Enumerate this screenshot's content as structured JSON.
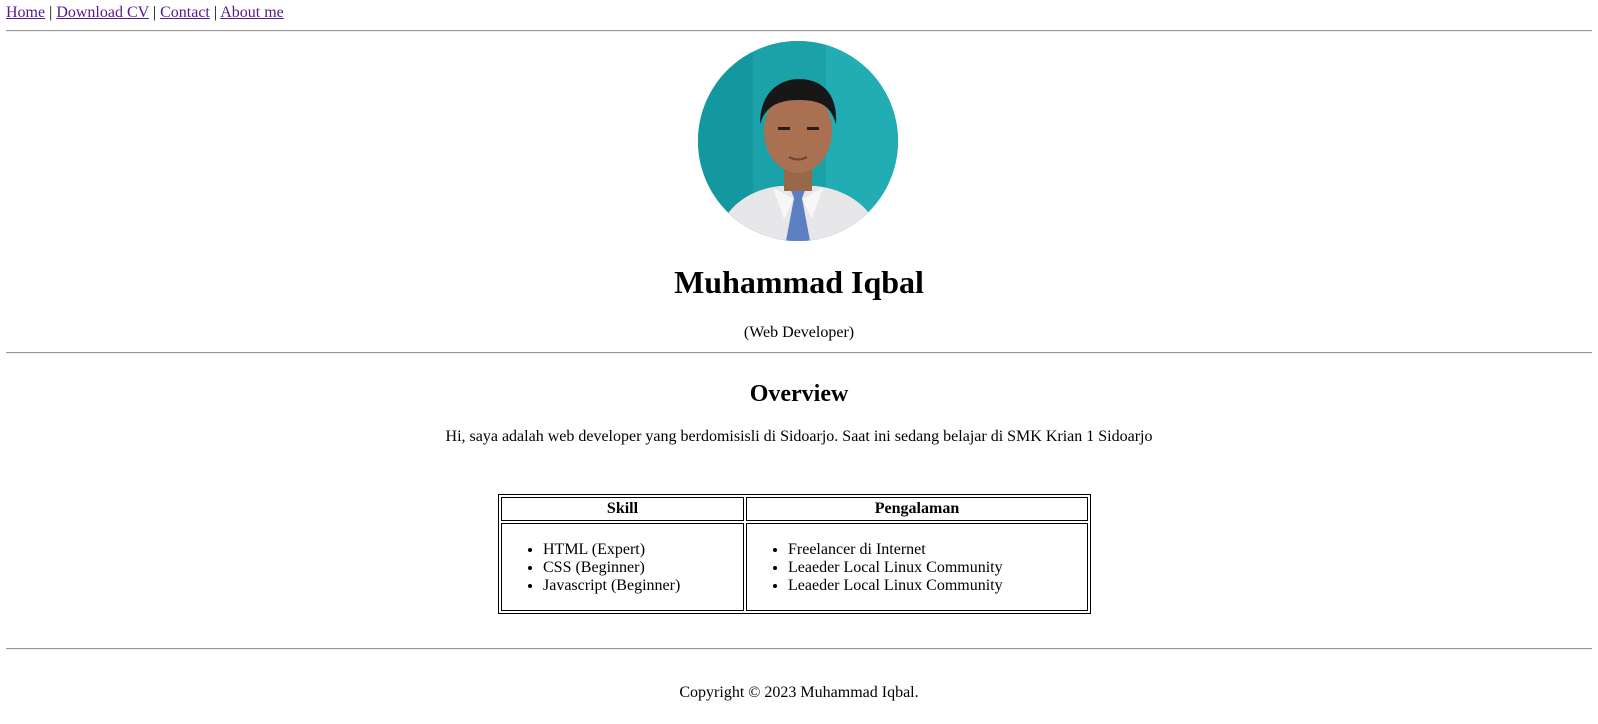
{
  "nav": {
    "home": "Home",
    "download_cv": "Download CV",
    "contact": "Contact",
    "about": "About me",
    "separator": "|"
  },
  "profile": {
    "photo_description": "profile photo",
    "name": "Muhammad Iqbal",
    "role": "(Web Developer)"
  },
  "overview": {
    "heading": "Overview",
    "text": "Hi, saya adalah web developer yang berdomisisli di Sidoarjo. Saat ini sedang belajar di SMK Krian 1 Sidoarjo"
  },
  "table": {
    "headers": [
      "Skill",
      "Pengalaman"
    ],
    "skills": [
      "HTML (Expert)",
      "CSS (Beginner)",
      "Javascript (Beginner)"
    ],
    "experience": [
      "Freelancer di Internet",
      "Leaeder Local Linux Community",
      "Leaeder Local Linux Community"
    ]
  },
  "footer": {
    "copyright": "Copyright © 2023 Muhammad Iqbal."
  },
  "colors": {
    "link_visited": "#551a8b",
    "rule": "#9a9a9a",
    "avatar_background": "#1ba3a9"
  }
}
